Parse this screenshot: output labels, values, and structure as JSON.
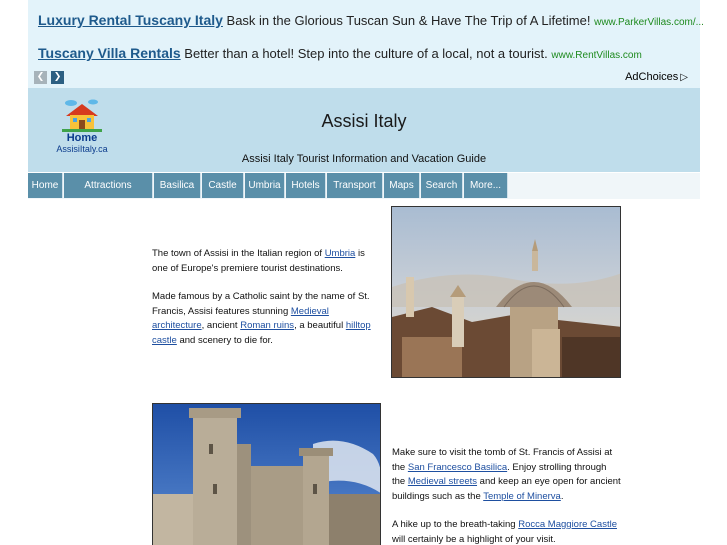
{
  "ads": [
    {
      "title": "Luxury Rental Tuscany Italy",
      "body": "Bask in the Glorious Tuscan Sun & Have The Trip of A Lifetime!",
      "url": "www.ParkerVillas.com/..."
    },
    {
      "title": "Tuscany Villa Rentals",
      "body": "Better than a hotel! Step into the culture of a local, not a tourist.",
      "url": "www.RentVillas.com"
    }
  ],
  "adchoices": "AdChoices",
  "logo": {
    "home": "Home",
    "site": "AssisiItaly.ca"
  },
  "site_title": "Assisi Italy",
  "tagline": "Assisi Italy Tourist Information and Vacation Guide",
  "nav": [
    "Home",
    "Attractions",
    "Basilica",
    "Castle",
    "Umbria",
    "Hotels",
    "Transport",
    "Maps",
    "Search",
    "More..."
  ],
  "content": {
    "p1": {
      "pre": "The town of Assisi in the Italian region of ",
      "link": "Umbria",
      "post": " is one of Europe's premiere tourist destinations."
    },
    "p2": {
      "pre": "Made famous by a Catholic saint by the name of St. Francis, Assisi features stunning ",
      "link1": "Medieval architecture",
      "mid1": ", ancient ",
      "link2": "Roman ruins",
      "mid2": ", a beautiful ",
      "link3": "hilltop castle",
      "post": " and scenery to die for."
    },
    "p3": {
      "pre": "Make sure to visit the tomb of St. Francis of Assisi at the ",
      "link1": "San Francesco Basilica",
      "mid1": ".  Enjoy strolling through the ",
      "link2": "Medieval streets",
      "mid2": " and keep an eye open for ancient buildings such as the ",
      "link3": "Temple of Minerva",
      "post": "."
    },
    "p4": {
      "pre": "A hike up to the breath-taking ",
      "link": "Rocca Maggiore Castle",
      "post": " will certainly be a highlight of your visit."
    }
  }
}
